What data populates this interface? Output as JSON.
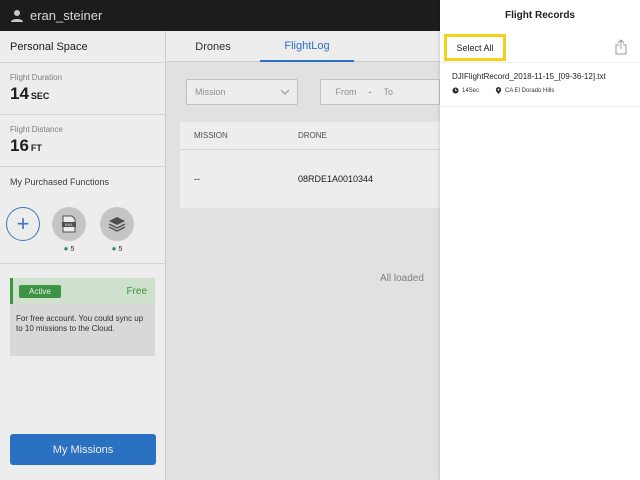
{
  "topbar": {
    "username": "eran_steiner",
    "user_icon": "user-icon"
  },
  "sidebar": {
    "personal_space": "Personal Space",
    "flight_duration": {
      "label": "Flight Duration",
      "value": "14",
      "unit": "SEC"
    },
    "flight_distance": {
      "label": "Flight Distance",
      "value": "16",
      "unit": "FT"
    },
    "purchased_title": "My Purchased Functions",
    "functions": [
      {
        "icon": "kml-icon",
        "count": "5"
      },
      {
        "icon": "layers-icon",
        "count": "5"
      }
    ],
    "plan": {
      "status": "Active",
      "tier": "Free",
      "note": "For free account. You could sync up to 10 missions to the Cloud."
    },
    "my_missions": "My Missions"
  },
  "main": {
    "tabs": [
      {
        "label": "Drones",
        "active": false
      },
      {
        "label": "FlightLog",
        "active": true
      }
    ],
    "mission_placeholder": "Mission",
    "date_from": "From",
    "date_dash": "-",
    "date_to": "To",
    "columns": [
      "MISSION",
      "DRONE"
    ],
    "rows": [
      {
        "mission": "--",
        "drone": "08RDE1A0010344"
      }
    ],
    "all_loaded": "All loaded"
  },
  "panel": {
    "title": "Flight Records",
    "select_all": "Select All",
    "share_icon": "share-icon",
    "records": [
      {
        "name": "DJIFlightRecord_2018-11-15_[09-36-12].txt",
        "duration": "14Sec",
        "location": "CA El Dorado Hills"
      }
    ]
  },
  "colors": {
    "accent": "#2f7ad1",
    "active_green": "#41a04a",
    "highlight": "#f2d21d",
    "topbar": "#1f1f1f"
  }
}
